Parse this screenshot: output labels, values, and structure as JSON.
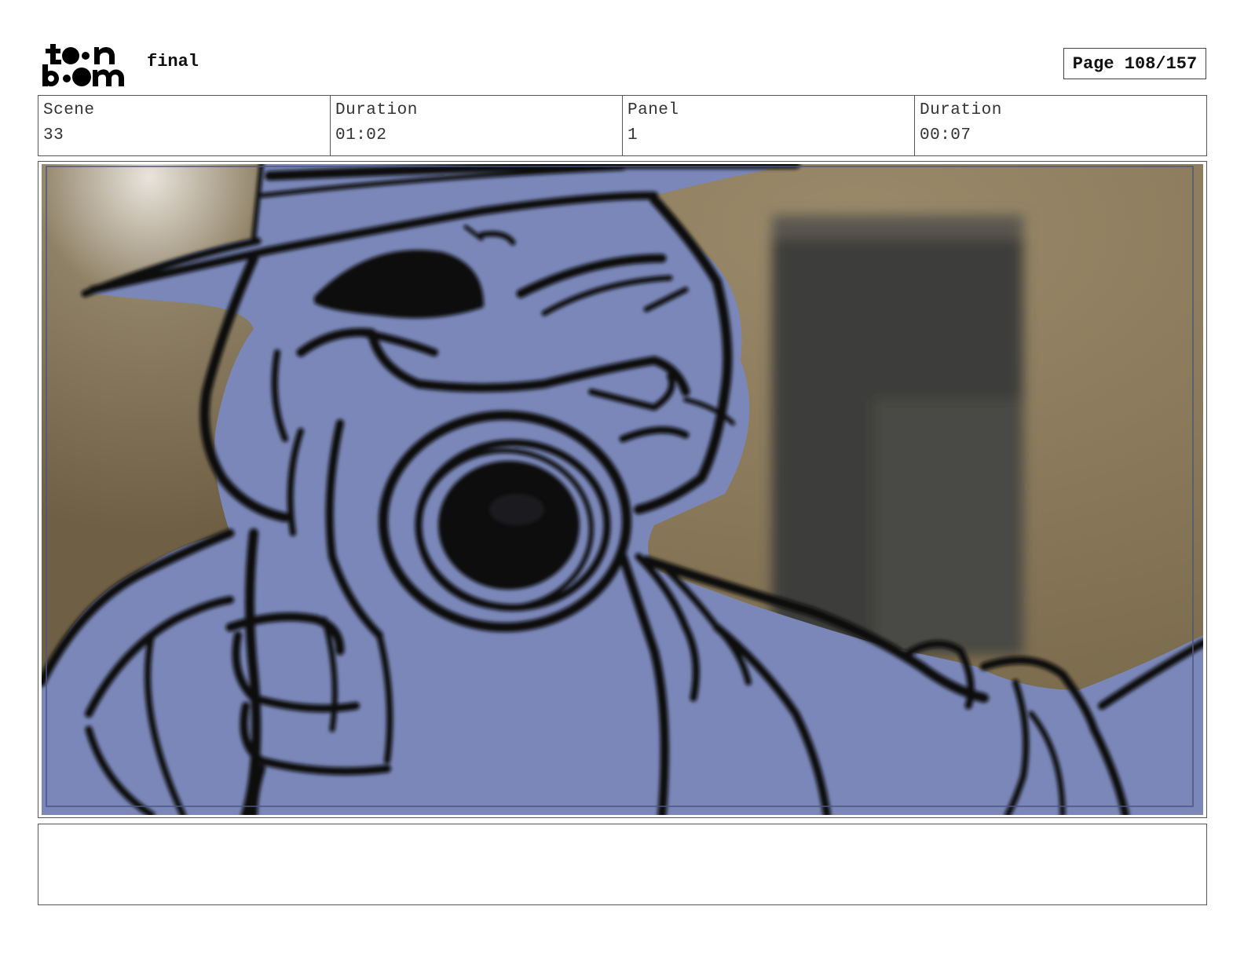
{
  "header": {
    "logo_text_top": "toon",
    "logo_text_bottom": "boom",
    "document_title": "final",
    "page_indicator": "Page 108/157"
  },
  "info": {
    "scene_label": "Scene",
    "scene_value": "33",
    "scene_duration_label": "Duration",
    "scene_duration_value": "01:02",
    "panel_label": "Panel",
    "panel_value": "1",
    "panel_duration_label": "Duration",
    "panel_duration_value": "00:07"
  },
  "panel": {
    "colors": {
      "character_fill": "#7a87b8",
      "ink": "#0a0a0a",
      "wall": "#8a7a5c",
      "doorway": "#3f3e3c"
    }
  },
  "notes": {
    "text": ""
  }
}
